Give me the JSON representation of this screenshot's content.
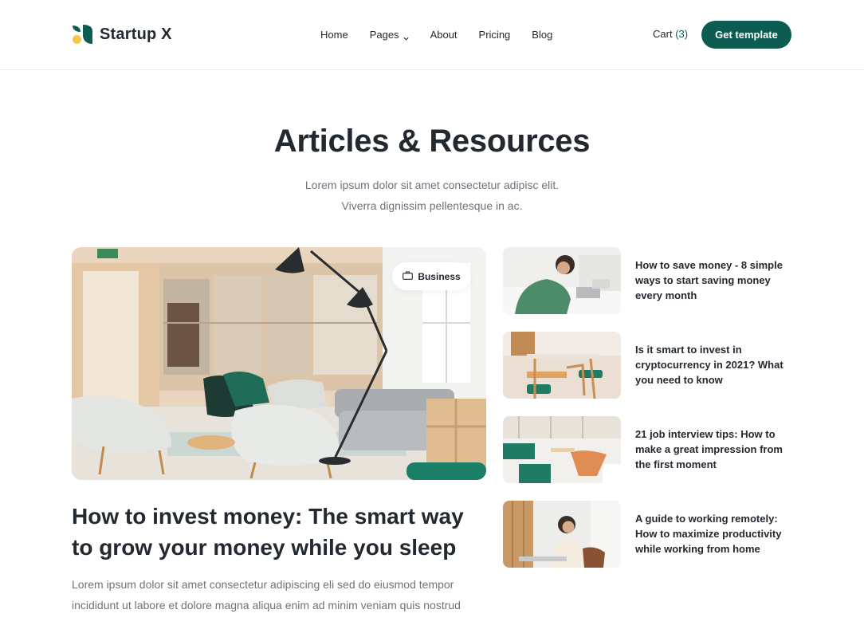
{
  "brand": {
    "name": "Startup X",
    "logo_icon": "leaf-logo-icon",
    "colors": {
      "green": "#0d5c52",
      "yellow": "#f2c94c"
    }
  },
  "nav": {
    "items": [
      "Home",
      "Pages",
      "About",
      "Pricing",
      "Blog"
    ]
  },
  "cart": {
    "label": "Cart",
    "count": "(3)"
  },
  "cta": {
    "label": "Get template"
  },
  "section": {
    "title": "Articles & Resources",
    "subtitle_line1": "Lorem ipsum dolor sit amet consectetur adipisc elit.",
    "subtitle_line2": "Viverra dignissim pellentesque in ac."
  },
  "featured": {
    "badge": "Business",
    "badge_icon": "briefcase-icon",
    "title": "How to invest money: The smart way to grow your money while you sleep",
    "excerpt": "Lorem ipsum dolor sit amet consectetur adipiscing eli sed do eiusmod tempor incididunt ut labore et dolore magna aliqua enim ad minim veniam quis nostrud"
  },
  "side_articles": [
    {
      "title": "How to save money - 8 simple ways to start saving money every month"
    },
    {
      "title": "Is it smart to invest in cryptocurrency in 2021?  What you need to know"
    },
    {
      "title": "21 job interview tips: How to make a great impression from the first moment"
    },
    {
      "title": "A guide to working remotely: How to maximize productivity while working from home"
    }
  ]
}
